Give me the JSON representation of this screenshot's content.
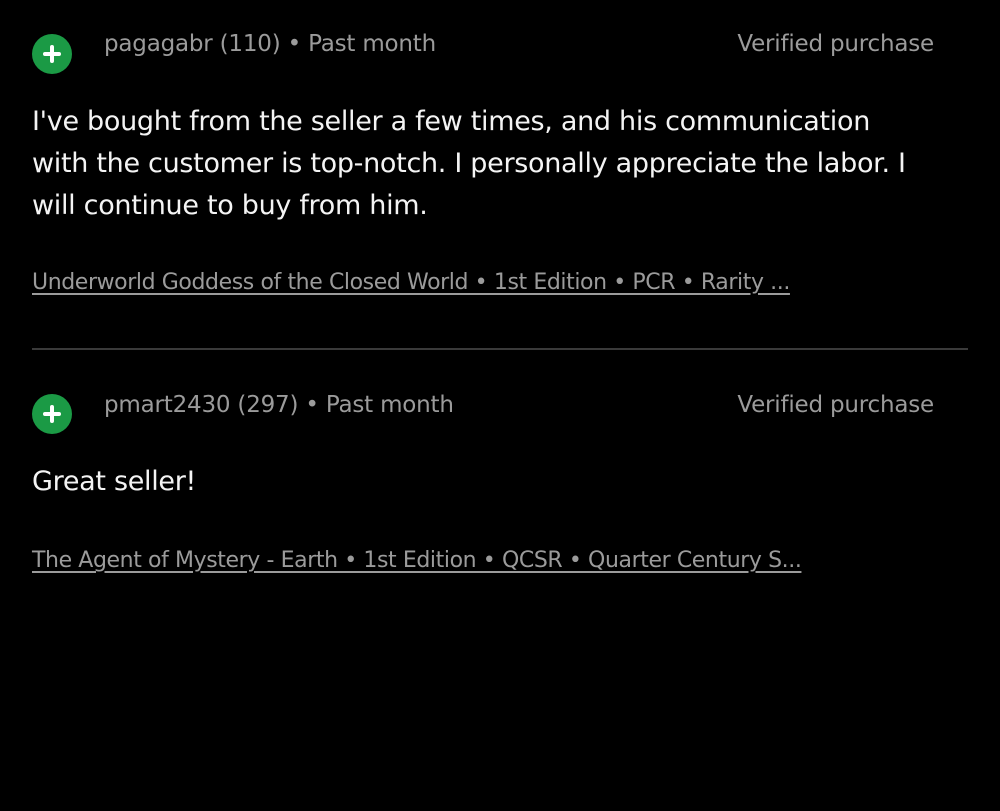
{
  "reviews": [
    {
      "username": "pagagabr",
      "score": "(110)",
      "separator": "•",
      "time": "Past month",
      "meta_line": "pagagabr (110) • Past month",
      "verified": "Verified purchase",
      "comment": "I've bought from the seller a few times, and his communication with the customer is top-notch. I personally appreciate the labor. I will continue to buy from him.",
      "item": "Underworld Goddess of the Closed World • 1st Edition • PCR • Rarity ..."
    },
    {
      "username": "pmart2430",
      "score": "(297)",
      "separator": "•",
      "time": "Past month",
      "meta_line": "pmart2430 (297) • Past month",
      "verified": "Verified purchase",
      "comment": "Great seller!",
      "item": "The Agent of Mystery - Earth • 1st Edition • QCSR • Quarter Century S..."
    }
  ],
  "icons": {
    "feedback_icon": "plus-icon",
    "feedback_color": "#1b9a45"
  },
  "colors": {
    "background": "#000000",
    "text": "#f4f4f4",
    "muted": "#9b9b9b",
    "divider": "#3a3a3a"
  }
}
